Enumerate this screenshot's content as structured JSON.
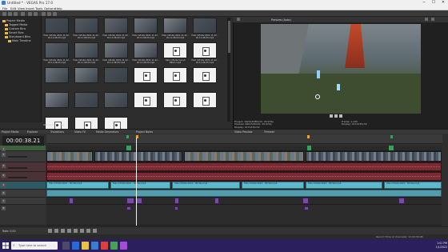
{
  "window": {
    "title": "Untitled * - VEGAS Pro 17.0",
    "controls": [
      "─",
      "☐",
      "✕"
    ]
  },
  "menu": [
    "File",
    "Edit",
    "View",
    "Insert",
    "Tools",
    "Options",
    "Help"
  ],
  "explorer": {
    "tree": [
      "Project Media",
      "Tagged Media",
      "Custom Bins",
      "Smart Bins",
      "Storyboard Bins",
      "Main Timeline"
    ],
    "items": [
      {
        "caption": "Halo Infinite 2021.11.22 - 20.11.08.03.mp4",
        "kind": "video"
      },
      {
        "caption": "Halo Infinite 2021.11.22 - 20.11.08.03.mp4",
        "kind": "video"
      },
      {
        "caption": "Halo Infinite 2021.11.22 - 20.11.08.03.mp4",
        "kind": "video"
      },
      {
        "caption": "Halo Infinite 2021.11.22 - 20.11.08.03.mp4",
        "kind": "video"
      },
      {
        "caption": "Halo Infinite 2021.11.22 - 20.11.08.03.mp4",
        "kind": "video"
      },
      {
        "caption": "Halo Infinite 2021.11.22 - 20.11.08.03.mp4",
        "kind": "video"
      },
      {
        "caption": "Halo Infinite 2021.11.22 - 20.11.08.03.mp4",
        "kind": "video"
      },
      {
        "caption": "Halo Infinite 2021.11.22 - 20.11.08.03.mp4",
        "kind": "video"
      },
      {
        "caption": "Halo Infinite 2021.11.22 - 20.11.08.03.mp4",
        "kind": "video"
      },
      {
        "caption": "Halo Infinite 2021.11.22 - 20.11.08.03.mp4",
        "kind": "video"
      },
      {
        "caption": "Halo Infinite Sound Effect.mp4",
        "kind": "doc"
      },
      {
        "caption": "Halo Infinite 2021.11.22 - 20.11.08.03.mp4",
        "kind": "doc"
      },
      {
        "caption": "",
        "kind": "video"
      },
      {
        "caption": "",
        "kind": "video"
      },
      {
        "caption": "",
        "kind": "video"
      },
      {
        "caption": "",
        "kind": "doc"
      },
      {
        "caption": "",
        "kind": "doc"
      },
      {
        "caption": "",
        "kind": "doc"
      },
      {
        "caption": "",
        "kind": "video"
      },
      {
        "caption": "",
        "kind": "video"
      },
      {
        "caption": "",
        "kind": "video"
      },
      {
        "caption": "",
        "kind": "doc"
      },
      {
        "caption": "",
        "kind": "doc"
      },
      {
        "caption": "",
        "kind": "doc"
      },
      {
        "caption": "",
        "kind": "doc"
      },
      {
        "caption": "",
        "kind": "doc"
      },
      {
        "caption": "",
        "kind": "doc"
      }
    ],
    "bottom_label": "Official Audio File"
  },
  "preview": {
    "label": "Preview (Auto)",
    "info_left": [
      "Project: 1920x1080x32, 29.970p",
      "Preview: 960x540x32, 29.970p",
      "Display: 417x235x32"
    ],
    "info_right": [
      "Frame: 1,155",
      "Display: 417x235x32"
    ]
  },
  "tabs": [
    "Project Media",
    "Explorer",
    "Transitions",
    "Video FX",
    "Media Generators",
    "Project Notes",
    "Video Preview",
    "Trimmer"
  ],
  "timeline": {
    "timecode": "00:00:38.21",
    "rate": "Rate: 0.00",
    "text_clips": [
      "Halo Infinite 2021 - HD Ste.mp4",
      "Halo Infinite 2021 - HD Ste.mp4",
      "Halo Infinite 2021 - HD Ste.mp4",
      "Halo Infinite 2021 - HD Ste.mp4",
      "Halo Infinite 2021 - HD Ste.mp4",
      "Halo Infinite 2021 - HD Ste.mp4"
    ],
    "track_numbers": [
      "1",
      "2",
      "3",
      "4",
      "5",
      "6",
      "7",
      "8"
    ]
  },
  "status": {
    "left": "",
    "right": "Record Time (2 channels): 12:00:39:08"
  },
  "taskbar": {
    "search_placeholder": "Type here to search",
    "time": "1:01 PM",
    "date": "1/1/2022"
  },
  "colors": {
    "audio": "#7a2a33",
    "text_track": "#5fb8cc",
    "purple": "#7a4aa8",
    "taskbar": "#2b1f5e"
  }
}
